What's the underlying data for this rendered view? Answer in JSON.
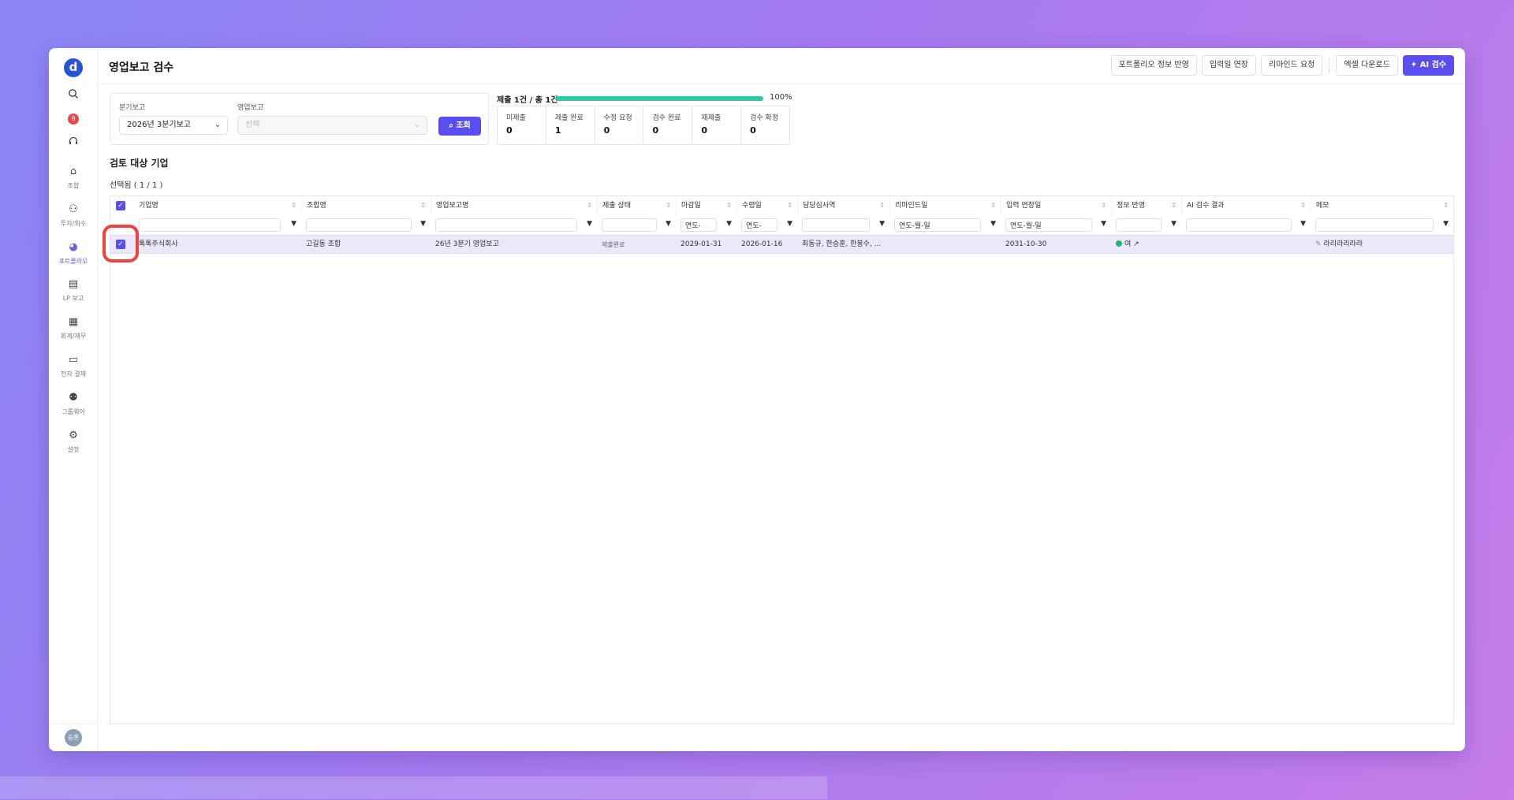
{
  "app": {
    "logo_letter": "d",
    "title": "영업보고 검수"
  },
  "sidebar": {
    "badge": "8",
    "items": [
      {
        "icon": "union-icon",
        "glyph": "⌂",
        "label": "조합"
      },
      {
        "icon": "investment-icon",
        "glyph": "⚇",
        "label": "투자/회수"
      },
      {
        "icon": "portfolio-icon",
        "glyph": "◕",
        "label": "포트폴리오"
      },
      {
        "icon": "lp-report-icon",
        "glyph": "▤",
        "label": "LP 보고"
      },
      {
        "icon": "accounting-icon",
        "glyph": "▦",
        "label": "회계/재무"
      },
      {
        "icon": "e-approval-icon",
        "glyph": "▭",
        "label": "전자 결재"
      },
      {
        "icon": "groupware-icon",
        "glyph": "⚉",
        "label": "그룹웨어"
      },
      {
        "icon": "settings-icon",
        "glyph": "⚙",
        "label": "설정"
      }
    ],
    "avatar": "승훈",
    "active_color": "#6c5ce7"
  },
  "toolbar": {
    "portfolio_sync": "포트폴리오 정보 반영",
    "extend_deadline": "입력일 연장",
    "remind": "리마인드 요청",
    "excel_download": "엑셀 다운로드",
    "ai_review": "AI 검수"
  },
  "filters": {
    "quarter_label": "분기보고",
    "quarter_value": "2026년 3분기보고",
    "report_label": "영업보고",
    "report_placeholder": "선택",
    "search_button": "조회"
  },
  "submission": {
    "summary": "제출 1건 / 총 1건",
    "progress": 1.0,
    "percent_text": "100%",
    "stats": [
      {
        "label": "미제출",
        "value": "0"
      },
      {
        "label": "제출 완료",
        "value": "1"
      },
      {
        "label": "수정 요청",
        "value": "0"
      },
      {
        "label": "검수 완료",
        "value": "0"
      },
      {
        "label": "재제출",
        "value": "0"
      },
      {
        "label": "검수 확정",
        "value": "0"
      }
    ]
  },
  "section": {
    "title": "검토 대상 기업",
    "selected": "선택됨 ( 1 / 1 )"
  },
  "table": {
    "headers": [
      "기업명",
      "조합명",
      "영업보고명",
      "제출 상태",
      "마감일",
      "수령일",
      "담당심사역",
      "리마인드일",
      "입력 연장일",
      "정보 반영",
      "AI 검수 결과",
      "메모"
    ],
    "date_placeholder": "연도-월-일",
    "date_placeholder_short": "연도-",
    "row": {
      "company": "톡톡주식회사",
      "union": "고길동 조합",
      "report": "26년 3분기 영업보고",
      "status": "제출완료",
      "deadline": "2029-01-31",
      "received": "2026-01-16",
      "reviewers": "최동규, 한승훈, 한봉수, ...",
      "remind_date": "",
      "extension_date": "2031-10-30",
      "info_synced": "여",
      "ai_result": "",
      "memo": "라리라리라라"
    }
  },
  "colors": {
    "primary": "#5b4ef0",
    "progress": "#34c7a4",
    "selected_row": "#ebe8fb",
    "highlight": "#f0413d"
  }
}
